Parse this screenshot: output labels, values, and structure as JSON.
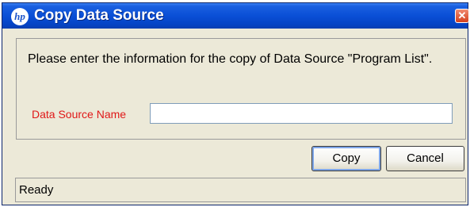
{
  "window": {
    "title": "Copy Data Source",
    "logo_text": "hp",
    "close_glyph": "✕"
  },
  "dialog": {
    "message": "Please enter the information for the copy of Data Source \"Program List\".",
    "field_label": "Data Source Name",
    "field_value": "",
    "field_placeholder": ""
  },
  "buttons": {
    "copy_label": "Copy",
    "cancel_label": "Cancel"
  },
  "status": {
    "text": "Ready"
  },
  "colors": {
    "titlebar": "#0a4fd6",
    "window_bg": "#ece9d8",
    "label_red": "#e01818",
    "close_red": "#d5401c"
  },
  "icons": {
    "app": "hp-logo-icon",
    "close": "close-icon"
  }
}
